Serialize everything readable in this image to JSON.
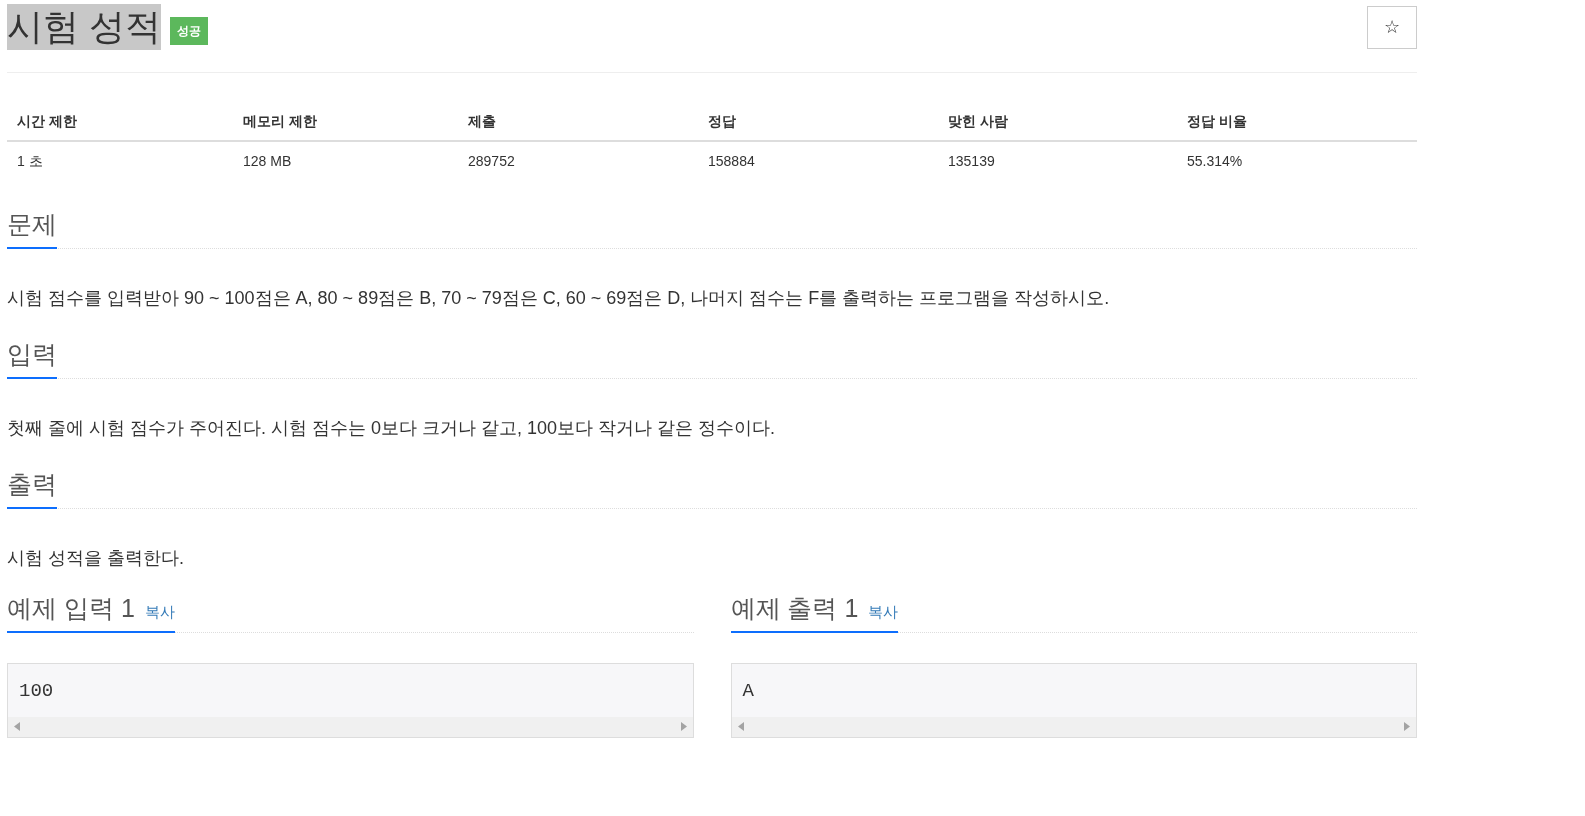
{
  "title": {
    "text": "시험 성적",
    "selected": true
  },
  "badge": "성공",
  "star_button": "☆",
  "stats": {
    "columns": [
      "시간 제한",
      "메모리 제한",
      "제출",
      "정답",
      "맞힌 사람",
      "정답 비율"
    ],
    "rows": [
      [
        "1 초",
        "128 MB",
        "289752",
        "158884",
        "135139",
        "55.314%"
      ]
    ]
  },
  "sections": [
    {
      "heading": "문제",
      "body": "시험 점수를 입력받아 90 ~ 100점은 A, 80 ~ 89점은 B, 70 ~ 79점은 C, 60 ~ 69점은 D, 나머지 점수는 F를 출력하는 프로그램을 작성하시오."
    },
    {
      "heading": "입력",
      "body": "첫째 줄에 시험 점수가 주어진다. 시험 점수는 0보다 크거나 같고, 100보다 작거나 같은 정수이다."
    },
    {
      "heading": "출력",
      "body": "시험 성적을 출력한다."
    }
  ],
  "samples": [
    {
      "heading": "예제 입력 1",
      "copy": "복사",
      "content": "100"
    },
    {
      "heading": "예제 출력 1",
      "copy": "복사",
      "content": "A"
    }
  ]
}
